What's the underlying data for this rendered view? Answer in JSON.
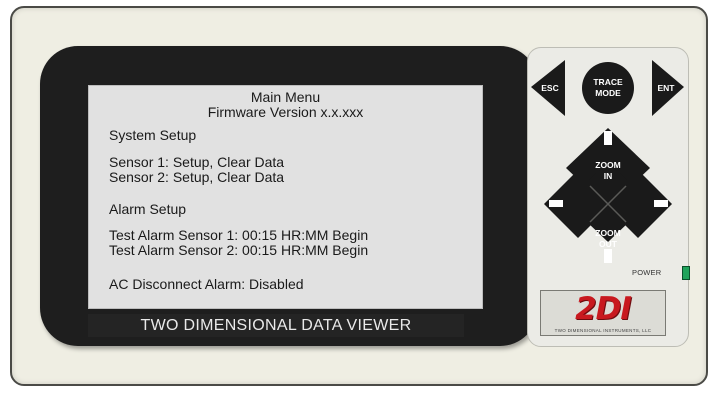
{
  "screen": {
    "title": "Main Menu",
    "firmware": "Firmware Version x.x.xxx",
    "items": [
      "System Setup",
      "Sensor 1:  Setup, Clear Data",
      "Sensor 2:  Setup, Clear Data",
      "Alarm Setup",
      "Test Alarm Sensor 1: 00:15 HR:MM Begin",
      "Test Alarm Sensor 2: 00:15 HR:MM Begin",
      "AC Disconnect Alarm:  Disabled"
    ]
  },
  "banner": "TWO DIMENSIONAL DATA VIEWER",
  "keypad": {
    "esc": "ESC",
    "trace_mode_1": "TRACE",
    "trace_mode_2": "MODE",
    "ent": "ENT",
    "zoom_in_1": "ZOOM",
    "zoom_in_2": "IN",
    "zoom_out_1": "ZOOM",
    "zoom_out_2": "OUT",
    "power": "POWER"
  },
  "logo": {
    "text": "2DI",
    "subtitle": "TWO DIMENSIONAL INSTRUMENTS, LLC"
  },
  "colors": {
    "frame": "#efeee3",
    "bezel": "#1e1e1e",
    "screen": "#e1e1e1",
    "key": "#1a1a1a",
    "led": "#1fa35b",
    "logo_red": "#c8191f"
  }
}
